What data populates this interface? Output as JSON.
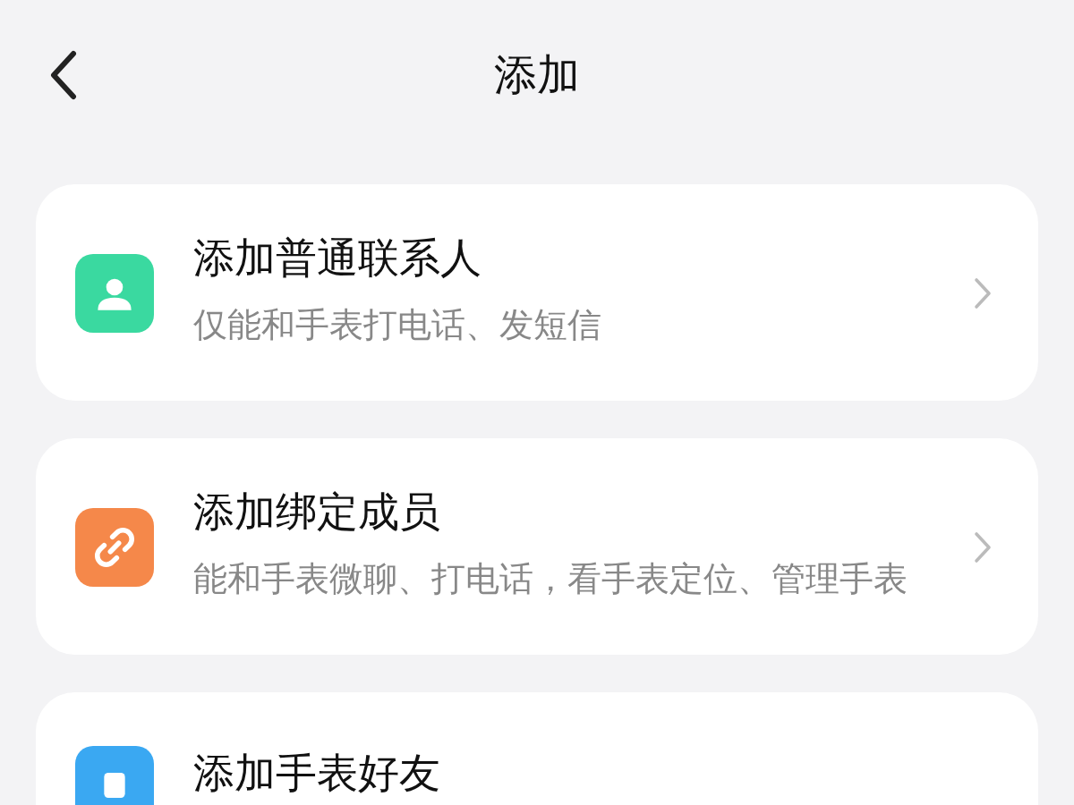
{
  "header": {
    "title": "添加"
  },
  "items": [
    {
      "kind": "person",
      "color": "#3ad9a0",
      "title": "添加普通联系人",
      "subtitle": "仅能和手表打电话、发短信"
    },
    {
      "kind": "link",
      "color": "#f5884a",
      "title": "添加绑定成员",
      "subtitle": "能和手表微聊、打电话，看手表定位、管理手表"
    },
    {
      "kind": "watch",
      "color": "#3aa8f2",
      "title": "添加手表好友"
    }
  ]
}
